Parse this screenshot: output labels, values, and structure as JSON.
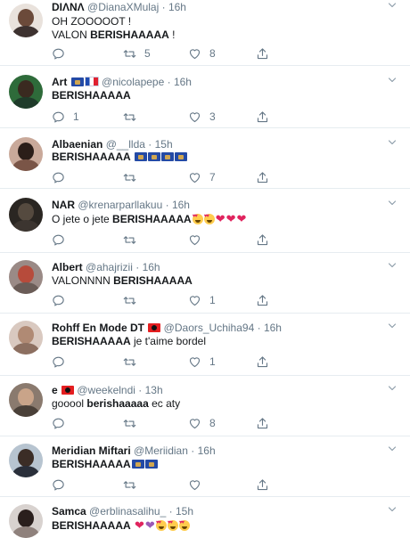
{
  "colors": {
    "icon": "#657786",
    "text": "#14171a",
    "divider": "#e6ecf0"
  },
  "icons": {
    "reply": "reply-icon",
    "retweet": "retweet-icon",
    "like": "like-icon",
    "share": "share-icon",
    "more": "chevron-down-icon"
  },
  "tweets": [
    {
      "name": "DIΛNΛ",
      "handle": "@DianaXMulaj",
      "time": "16h",
      "line1": "OH ZOOOOOT !",
      "line2_plain": "VALON ",
      "line2_bold": "BERISHAAAAA",
      "line2_tail": " !",
      "reply_count": "",
      "retweet_count": "5",
      "like_count": "8"
    },
    {
      "name": "Art",
      "handle": "@nicolapepe",
      "time": "16h",
      "text_bold": "BERISHAAAAA",
      "reply_count": "1",
      "retweet_count": "",
      "like_count": "3"
    },
    {
      "name": "Albaenian",
      "handle": "@__llda",
      "time": "15h",
      "text_bold": "BERISHAAAAA",
      "reply_count": "",
      "retweet_count": "",
      "like_count": "7"
    },
    {
      "name": "NAR",
      "handle": "@krenarparllakuu",
      "time": "16h",
      "text_plain": "O jete o jete ",
      "text_bold": "BERISHAAAAA",
      "reply_count": "",
      "retweet_count": "",
      "like_count": ""
    },
    {
      "name": "Albert",
      "handle": "@ahajrizii",
      "time": "16h",
      "text_plain": "VALONNNN ",
      "text_bold": "BERISHAAAAA",
      "reply_count": "",
      "retweet_count": "",
      "like_count": "1"
    },
    {
      "name": "Rohff En Mode DT",
      "handle": "@Daors_Uchiha94",
      "time": "16h",
      "text_bold": "BERISHAAAAA",
      "text_tail": " je t'aime bordel",
      "reply_count": "",
      "retweet_count": "",
      "like_count": "1"
    },
    {
      "name": "e",
      "handle": "@weekelndi",
      "time": "13h",
      "text_plain": "gooool ",
      "text_bold": "berishaaaaa",
      "text_tail": " ec aty",
      "reply_count": "",
      "retweet_count": "",
      "like_count": "8"
    },
    {
      "name": "Meridian Miftari",
      "handle": "@Meriidian",
      "time": "16h",
      "text_bold": "BERISHAAAAA",
      "reply_count": "",
      "retweet_count": "",
      "like_count": ""
    },
    {
      "name": "Samca",
      "handle": "@erblinasalihu_",
      "time": "15h",
      "text_bold": "BERISHAAAAA"
    }
  ]
}
